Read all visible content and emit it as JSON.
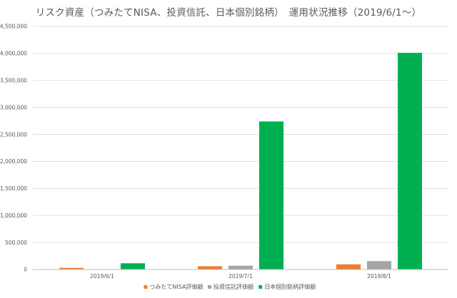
{
  "chart_data": {
    "type": "bar",
    "title": "リスク資産（つみたてNISA、投資信託、日本個別銘柄）　運用状況推移（2019/6/1～）",
    "categories": [
      "2019/6/1",
      "2019/7/1",
      "2019/8/1"
    ],
    "series": [
      {
        "name": "つみたてNISA評価額",
        "color": "#ED7D31",
        "values": [
          30000,
          60000,
          95000
        ]
      },
      {
        "name": "投資信託評価額",
        "color": "#A5A5A5",
        "values": [
          0,
          70000,
          155000
        ]
      },
      {
        "name": "日本個別銘柄評価額",
        "color": "#00B050",
        "values": [
          115000,
          2740000,
          4010000
        ]
      }
    ],
    "ylim": [
      0,
      4500000
    ],
    "yticks": [
      0,
      500000,
      1000000,
      1500000,
      2000000,
      2500000,
      3000000,
      3500000,
      4000000,
      4500000
    ],
    "ytick_labels": [
      "0",
      "500,000",
      "1,000,000",
      "1,500,000",
      "2,000,000",
      "2,500,000",
      "3,000,000",
      "3,500,000",
      "4,000,000",
      "4,500,000"
    ],
    "grid": true,
    "legend_position": "bottom"
  }
}
